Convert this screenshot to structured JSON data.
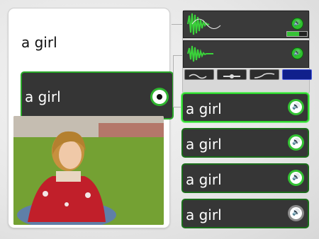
{
  "prompt": {
    "text": "a girl"
  },
  "selected_answer": {
    "label": "a girl",
    "icon": "radio-selected-icon"
  },
  "photo": {
    "alt": ""
  },
  "audio_panel": {
    "speaker_icon": "speaker-icon",
    "volume_level": 0.6,
    "slider_position": 0.5,
    "modes": [
      {
        "icon": "waveform-mode-icon"
      },
      {
        "icon": "spectrum-mode-icon"
      },
      {
        "icon": "curve-mode-icon"
      },
      {
        "icon": "blue-mode-icon",
        "active": true
      }
    ]
  },
  "answers": [
    {
      "label": "a girl",
      "highlighted": true,
      "audio_enabled": true
    },
    {
      "label": "a girl",
      "highlighted": false,
      "audio_enabled": true
    },
    {
      "label": "a girl",
      "highlighted": false,
      "audio_enabled": true
    },
    {
      "label": "a girl",
      "highlighted": false,
      "audio_enabled": false
    }
  ],
  "colors": {
    "accent": "#2fc02f",
    "card_bg": "#363636",
    "active_mode": "#10208c"
  }
}
